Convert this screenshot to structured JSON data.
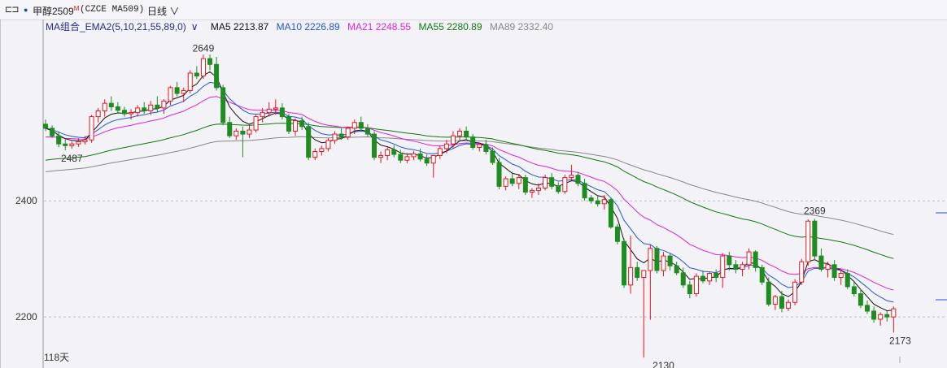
{
  "topbar": {
    "icon": "switch-icon",
    "dot": "●",
    "symbol": "甲醇2509",
    "symbol_mark": "M",
    "code": "(CZCE MA509)",
    "period": "日线",
    "period_caret": "∨"
  },
  "indicator": {
    "group_label": "MA组合_EMA2(5,10,21,55,89,0)",
    "caret": "∨",
    "ma5": "MA5 2213.87",
    "ma10": "MA10 2226.89",
    "ma21": "MA21 2248.55",
    "ma55": "MA55 2280.89",
    "ma89": "MA89 2332.40"
  },
  "footer": {
    "days": "118天"
  },
  "colors": {
    "up": "#e8141e",
    "down": "#1e8c1e",
    "ma5": "#111111",
    "ma10": "#2255dd",
    "ma21": "#dd22dd",
    "ma55": "#117711",
    "ma89": "#888888",
    "label_up": "#d01010",
    "label_down": "#107010"
  },
  "chart_data": {
    "type": "candlestick",
    "y_ticks": [
      "2400",
      "2200"
    ],
    "ylim": [
      2112,
      2690
    ],
    "grid": "dashed horizontal at ticks",
    "annotations": [
      {
        "text": "2649",
        "value": 2649,
        "index": 24,
        "kind": "high"
      },
      {
        "text": "2487",
        "value": 2487,
        "index": 4,
        "kind": "low"
      },
      {
        "text": "2369",
        "value": 2369,
        "index": 117,
        "kind": "high"
      },
      {
        "text": "2130",
        "value": 2130,
        "index": 94,
        "kind": "low"
      },
      {
        "text": "2173",
        "value": 2173,
        "index": 130,
        "kind": "low"
      }
    ],
    "ohlc": [
      [
        2532,
        2540,
        2520,
        2525
      ],
      [
        2525,
        2530,
        2508,
        2512
      ],
      [
        2512,
        2520,
        2492,
        2498
      ],
      [
        2498,
        2508,
        2487,
        2495
      ],
      [
        2495,
        2502,
        2490,
        2498
      ],
      [
        2498,
        2508,
        2493,
        2502
      ],
      [
        2502,
        2512,
        2497,
        2505
      ],
      [
        2505,
        2548,
        2500,
        2545
      ],
      [
        2545,
        2560,
        2535,
        2555
      ],
      [
        2555,
        2575,
        2545,
        2568
      ],
      [
        2568,
        2580,
        2555,
        2562
      ],
      [
        2562,
        2570,
        2550,
        2556
      ],
      [
        2556,
        2562,
        2545,
        2550
      ],
      [
        2550,
        2558,
        2540,
        2552
      ],
      [
        2552,
        2565,
        2545,
        2560
      ],
      [
        2560,
        2570,
        2550,
        2555
      ],
      [
        2555,
        2572,
        2548,
        2565
      ],
      [
        2565,
        2580,
        2552,
        2560
      ],
      [
        2560,
        2575,
        2550,
        2572
      ],
      [
        2572,
        2598,
        2565,
        2595
      ],
      [
        2595,
        2605,
        2580,
        2585
      ],
      [
        2585,
        2595,
        2570,
        2590
      ],
      [
        2590,
        2625,
        2585,
        2620
      ],
      [
        2620,
        2632,
        2610,
        2615
      ],
      [
        2615,
        2652,
        2610,
        2645
      ],
      [
        2645,
        2652,
        2625,
        2635
      ],
      [
        2635,
        2648,
        2590,
        2595
      ],
      [
        2595,
        2600,
        2530,
        2535
      ],
      [
        2535,
        2545,
        2508,
        2512
      ],
      [
        2512,
        2525,
        2505,
        2520
      ],
      [
        2520,
        2528,
        2475,
        2515
      ],
      [
        2515,
        2530,
        2508,
        2522
      ],
      [
        2522,
        2548,
        2518,
        2545
      ],
      [
        2545,
        2560,
        2535,
        2552
      ],
      [
        2552,
        2570,
        2545,
        2558
      ],
      [
        2558,
        2575,
        2548,
        2560
      ],
      [
        2560,
        2568,
        2540,
        2545
      ],
      [
        2545,
        2550,
        2515,
        2520
      ],
      [
        2520,
        2542,
        2512,
        2538
      ],
      [
        2538,
        2545,
        2522,
        2528
      ],
      [
        2528,
        2535,
        2470,
        2475
      ],
      [
        2475,
        2490,
        2470,
        2485
      ],
      [
        2485,
        2495,
        2478,
        2490
      ],
      [
        2490,
        2508,
        2485,
        2504
      ],
      [
        2504,
        2520,
        2498,
        2515
      ],
      [
        2515,
        2525,
        2505,
        2510
      ],
      [
        2510,
        2528,
        2505,
        2525
      ],
      [
        2525,
        2540,
        2515,
        2535
      ],
      [
        2535,
        2545,
        2520,
        2525
      ],
      [
        2525,
        2532,
        2510,
        2515
      ],
      [
        2515,
        2520,
        2470,
        2475
      ],
      [
        2475,
        2485,
        2465,
        2478
      ],
      [
        2478,
        2492,
        2470,
        2488
      ],
      [
        2488,
        2496,
        2475,
        2480
      ],
      [
        2480,
        2488,
        2465,
        2470
      ],
      [
        2470,
        2482,
        2465,
        2476
      ],
      [
        2476,
        2486,
        2470,
        2481
      ],
      [
        2481,
        2490,
        2468,
        2472
      ],
      [
        2472,
        2480,
        2460,
        2465
      ],
      [
        2465,
        2472,
        2440,
        2478
      ],
      [
        2478,
        2495,
        2472,
        2490
      ],
      [
        2490,
        2505,
        2482,
        2498
      ],
      [
        2498,
        2520,
        2490,
        2512
      ],
      [
        2512,
        2525,
        2505,
        2520
      ],
      [
        2520,
        2528,
        2505,
        2510
      ],
      [
        2510,
        2515,
        2488,
        2492
      ],
      [
        2492,
        2500,
        2485,
        2497
      ],
      [
        2497,
        2505,
        2480,
        2485
      ],
      [
        2485,
        2492,
        2462,
        2466
      ],
      [
        2466,
        2474,
        2420,
        2425
      ],
      [
        2425,
        2442,
        2418,
        2438
      ],
      [
        2438,
        2450,
        2425,
        2430
      ],
      [
        2430,
        2446,
        2420,
        2440
      ],
      [
        2440,
        2445,
        2410,
        2415
      ],
      [
        2415,
        2422,
        2405,
        2418
      ],
      [
        2418,
        2430,
        2410,
        2422
      ],
      [
        2422,
        2445,
        2418,
        2440
      ],
      [
        2440,
        2448,
        2420,
        2425
      ],
      [
        2425,
        2432,
        2412,
        2416
      ],
      [
        2416,
        2445,
        2412,
        2440
      ],
      [
        2440,
        2462,
        2435,
        2444
      ],
      [
        2444,
        2450,
        2425,
        2430
      ],
      [
        2430,
        2438,
        2400,
        2405
      ],
      [
        2405,
        2410,
        2395,
        2400
      ],
      [
        2400,
        2408,
        2390,
        2395
      ],
      [
        2395,
        2410,
        2385,
        2402
      ],
      [
        2402,
        2405,
        2352,
        2355
      ],
      [
        2355,
        2360,
        2325,
        2330
      ],
      [
        2330,
        2335,
        2250,
        2255
      ],
      [
        2255,
        2340,
        2240,
        2285
      ],
      [
        2285,
        2295,
        2262,
        2268
      ],
      [
        2268,
        2272,
        2130,
        2280
      ],
      [
        2280,
        2325,
        2195,
        2318
      ],
      [
        2318,
        2322,
        2275,
        2280
      ],
      [
        2280,
        2312,
        2270,
        2305
      ],
      [
        2305,
        2310,
        2280,
        2288
      ],
      [
        2288,
        2295,
        2272,
        2276
      ],
      [
        2276,
        2285,
        2250,
        2255
      ],
      [
        2255,
        2262,
        2232,
        2240
      ],
      [
        2240,
        2275,
        2235,
        2270
      ],
      [
        2270,
        2280,
        2258,
        2262
      ],
      [
        2262,
        2278,
        2255,
        2275
      ],
      [
        2275,
        2282,
        2260,
        2268
      ],
      [
        2268,
        2310,
        2250,
        2305
      ],
      [
        2305,
        2312,
        2280,
        2290
      ],
      [
        2290,
        2298,
        2275,
        2282
      ],
      [
        2282,
        2295,
        2270,
        2290
      ],
      [
        2290,
        2318,
        2282,
        2312
      ],
      [
        2312,
        2315,
        2278,
        2285
      ],
      [
        2285,
        2290,
        2255,
        2260
      ],
      [
        2260,
        2268,
        2218,
        2222
      ],
      [
        2222,
        2238,
        2212,
        2235
      ],
      [
        2235,
        2245,
        2208,
        2215
      ],
      [
        2215,
        2230,
        2210,
        2225
      ],
      [
        2225,
        2265,
        2220,
        2260
      ],
      [
        2260,
        2300,
        2255,
        2295
      ],
      [
        2295,
        2368,
        2288,
        2365
      ],
      [
        2365,
        2369,
        2298,
        2305
      ],
      [
        2305,
        2318,
        2278,
        2282
      ],
      [
        2282,
        2295,
        2268,
        2290
      ],
      [
        2290,
        2298,
        2262,
        2268
      ],
      [
        2268,
        2282,
        2255,
        2275
      ],
      [
        2275,
        2282,
        2248,
        2252
      ],
      [
        2252,
        2262,
        2235,
        2240
      ],
      [
        2240,
        2248,
        2215,
        2220
      ],
      [
        2220,
        2228,
        2205,
        2210
      ],
      [
        2210,
        2218,
        2190,
        2196
      ],
      [
        2196,
        2208,
        2185,
        2204
      ],
      [
        2204,
        2210,
        2192,
        2200
      ],
      [
        2200,
        2218,
        2173,
        2214
      ]
    ]
  }
}
